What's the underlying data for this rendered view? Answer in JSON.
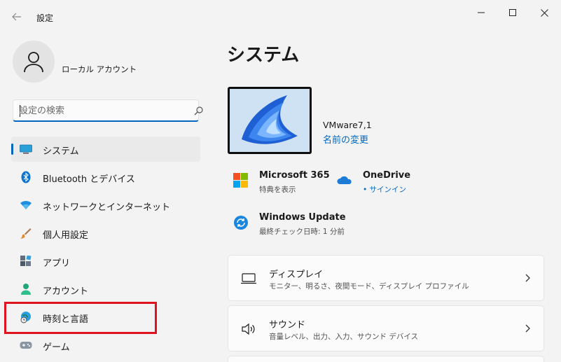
{
  "window": {
    "title": "設定"
  },
  "profile": {
    "name": "ローカル アカウント"
  },
  "search": {
    "placeholder": "設定の検索"
  },
  "sidebar": {
    "items": [
      {
        "label": "システム",
        "icon": "system-icon",
        "active": true
      },
      {
        "label": "Bluetooth とデバイス",
        "icon": "bluetooth-icon"
      },
      {
        "label": "ネットワークとインターネット",
        "icon": "wifi-icon"
      },
      {
        "label": "個人用設定",
        "icon": "brush-icon"
      },
      {
        "label": "アプリ",
        "icon": "apps-icon"
      },
      {
        "label": "アカウント",
        "icon": "account-icon"
      },
      {
        "label": "時刻と言語",
        "icon": "globe-clock-icon"
      },
      {
        "label": "ゲーム",
        "icon": "gamepad-icon"
      }
    ]
  },
  "main": {
    "title": "システム",
    "device": {
      "name": "VMware7,1",
      "rename_label": "名前の変更"
    },
    "quick": [
      {
        "title": "Microsoft 365",
        "subtitle": "特典を表示",
        "icon": "microsoft-logo-icon"
      },
      {
        "title": "OneDrive",
        "subtitle": "• サインイン",
        "icon": "onedrive-cloud-icon"
      },
      {
        "title": "Windows Update",
        "subtitle": "最終チェック日時: 1 分前",
        "icon": "windows-update-icon"
      }
    ],
    "cards": [
      {
        "title": "ディスプレイ",
        "subtitle": "モニター、明るさ、夜間モード、ディスプレイ プロファイル",
        "icon": "display-icon"
      },
      {
        "title": "サウンド",
        "subtitle": "音量レベル、出力、入力、サウンド デバイス",
        "icon": "speaker-icon"
      }
    ]
  },
  "colors": {
    "accent": "#0067c0",
    "highlight": "#e0141e",
    "background": "#f3f3f3"
  }
}
